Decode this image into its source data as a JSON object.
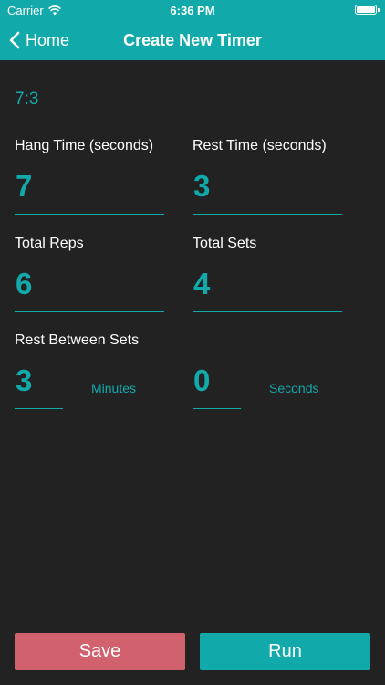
{
  "status_bar": {
    "carrier": "Carrier",
    "time": "6:36 PM",
    "wifi_icon": "wifi-icon",
    "battery_icon": "battery-icon"
  },
  "nav": {
    "back_label": "Home",
    "title": "Create New Timer"
  },
  "ratio_text": "7:3",
  "fields": {
    "hang_time": {
      "label": "Hang Time (seconds)",
      "value": "7"
    },
    "rest_time": {
      "label": "Rest Time (seconds)",
      "value": "3"
    },
    "total_reps": {
      "label": "Total Reps",
      "value": "6"
    },
    "total_sets": {
      "label": "Total Sets",
      "value": "4"
    }
  },
  "rest_between_sets": {
    "label": "Rest Between Sets",
    "minutes_value": "3",
    "minutes_label": "Minutes",
    "seconds_value": "0",
    "seconds_label": "Seconds"
  },
  "buttons": {
    "save": "Save",
    "run": "Run"
  },
  "colors": {
    "accent": "#11a9a9",
    "background": "#222222",
    "save": "#d0616d"
  }
}
